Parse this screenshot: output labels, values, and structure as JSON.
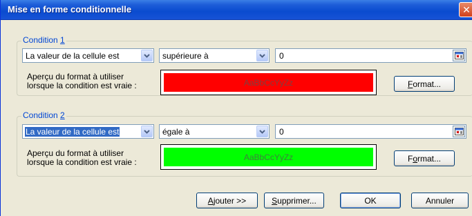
{
  "dialog": {
    "title": "Mise en forme conditionnelle",
    "close_glyph": "✕"
  },
  "conditions": [
    {
      "legend_prefix": "Condition ",
      "legend_num": "1",
      "type": "La valeur de la cellule est",
      "type_highlighted": false,
      "operator": "supérieure à",
      "value": "0",
      "preview_label_1": "Aperçu du format à utiliser",
      "preview_label_2": "lorsque la condition est vraie :",
      "preview_text": "AaBbCcYyZz",
      "preview_bg": "#ff0000",
      "preview_fg": "#7f3f3f",
      "format_prefix": "",
      "format_accel": "F",
      "format_rest": "ormat..."
    },
    {
      "legend_prefix": "Condition ",
      "legend_num": "2",
      "type": "La valeur de la cellule est",
      "type_highlighted": true,
      "operator": "égale à",
      "value": "0",
      "preview_label_1": "Aperçu du format à utiliser",
      "preview_label_2": "lorsque la condition est vraie :",
      "preview_text": "AaBbCcYyZz",
      "preview_bg": "#00ff00",
      "preview_fg": "#3f7f3f",
      "format_prefix": "F",
      "format_accel": "o",
      "format_rest": "rmat..."
    }
  ],
  "footer": {
    "add_accel": "A",
    "add_rest": "jouter >>",
    "delete_accel": "S",
    "delete_rest": "upprimer...",
    "ok": "OK",
    "cancel": "Annuler"
  },
  "icons": {
    "dropdown": "chevron-down-icon",
    "range_picker": "collapse-dialog-icon",
    "close": "close-icon"
  },
  "colors": {
    "titlebar": "#0a4bcf",
    "legend": "#0046d5",
    "selection": "#316ac5"
  }
}
